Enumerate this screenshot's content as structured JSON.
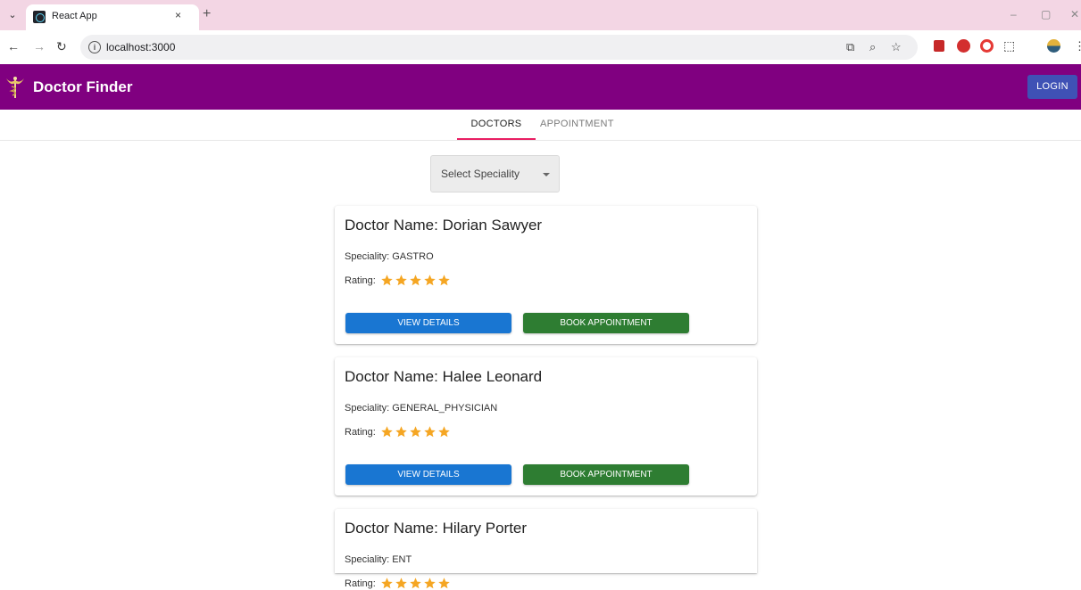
{
  "browser": {
    "tab_title": "React App",
    "tab_close": "×",
    "new_tab": "+",
    "url": "localhost:3000",
    "minimize": "–",
    "restore": "▢",
    "close": "✕"
  },
  "app": {
    "title": "Doctor Finder",
    "login_label": "LOGIN",
    "brand_color": "#800080",
    "login_color": "#3f51b5"
  },
  "tabs": [
    {
      "label": "DOCTORS",
      "active": true
    },
    {
      "label": "APPOINTMENT",
      "active": false
    }
  ],
  "filter": {
    "placeholder": "Select Speciality"
  },
  "doctors": [
    {
      "name": "Doctor Name: Dorian Sawyer",
      "speciality": "Speciality: GASTRO",
      "rating_label": "Rating:",
      "rating": 5
    },
    {
      "name": "Doctor Name: Halee Leonard",
      "speciality": "Speciality: GENERAL_PHYSICIAN",
      "rating_label": "Rating:",
      "rating": 5
    },
    {
      "name": "Doctor Name: Hilary Porter",
      "speciality": "Speciality: ENT",
      "rating_label": "Rating:",
      "rating": 5
    }
  ],
  "buttons": {
    "view_details": "VIEW DETAILS",
    "book_appointment": "BOOK APPOINTMENT"
  },
  "colors": {
    "view_button": "#1976d2",
    "book_button": "#2e7d32",
    "star": "#f5a623",
    "tab_indicator": "#e91e63"
  }
}
